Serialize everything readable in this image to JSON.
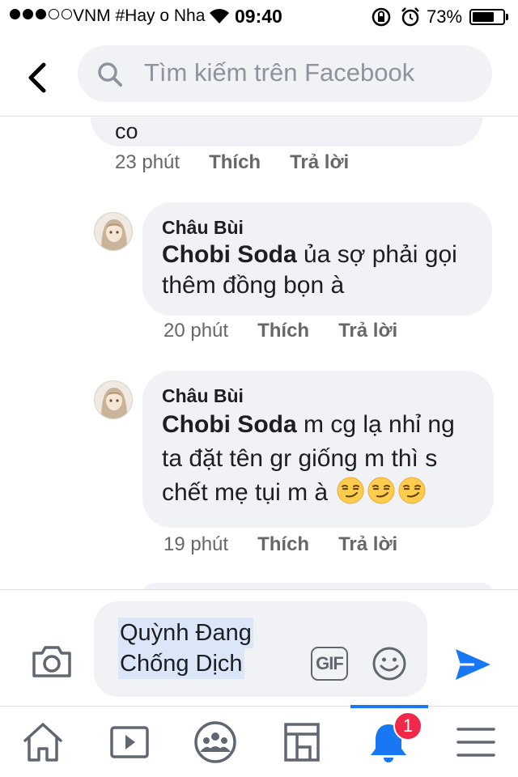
{
  "status_bar": {
    "carrier": "VNM #Hay o Nha",
    "time": "09:40",
    "battery_percent": "73%",
    "battery_level": 0.73
  },
  "header": {
    "search_placeholder": "Tìm kiếm trên Facebook"
  },
  "comments": [
    {
      "author": "",
      "mention": "",
      "text": "co",
      "time": "23 phút",
      "like_label": "Thích",
      "reply_label": "Trả lời"
    },
    {
      "author": "Châu Bùi",
      "mention": "Chobi Soda",
      "text_line1": " ủa sợ phải gọi",
      "text_line2": "thêm đồng bọn à",
      "time": "20 phút",
      "like_label": "Thích",
      "reply_label": "Trả lời"
    },
    {
      "author": "Châu Bùi",
      "mention": "Chobi Soda",
      "text_line1": " m cg lạ nhỉ ng",
      "text_line2": "ta đặt tên gr giống m thì s",
      "text_line3": "chết mẹ tụi m à",
      "emoji": "smirk-emoji",
      "emoji_count": 3,
      "time": "19 phút",
      "like_label": "Thích",
      "reply_label": "Trả lời"
    }
  ],
  "composer": {
    "typed_line1": "Quỳnh Đang",
    "typed_line2": "Chống Dịch",
    "gif_label": "GIF"
  },
  "tabbar": {
    "notification_badge": "1",
    "active_tab": "notifications",
    "accent": "#1877f2"
  },
  "icons": [
    "back-icon",
    "search-icon",
    "camera-icon",
    "gif-icon",
    "emoji-icon",
    "send-icon",
    "home-icon",
    "watch-icon",
    "groups-icon",
    "marketplace-icon",
    "bell-icon",
    "menu-icon"
  ]
}
